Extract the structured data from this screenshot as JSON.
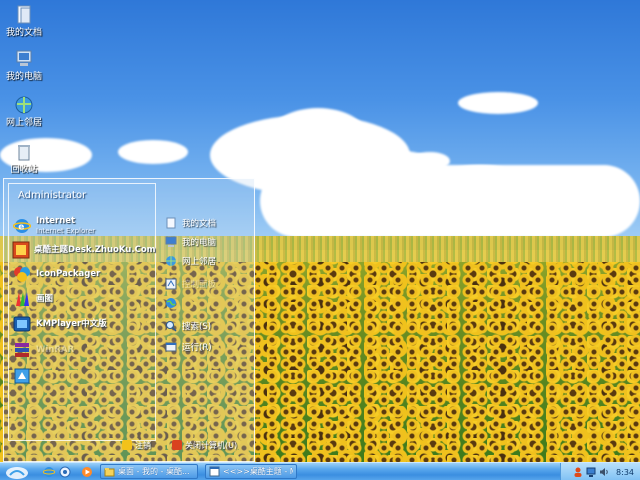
{
  "desktop": {
    "icons": [
      {
        "label": "我的文档",
        "icon": "documents-icon"
      },
      {
        "label": "我的电脑",
        "icon": "computer-icon"
      },
      {
        "label": "网上邻居",
        "icon": "network-icon"
      },
      {
        "label": "回收站",
        "icon": "recycle-bin-icon"
      }
    ]
  },
  "start_menu": {
    "user_name": "Administrator",
    "programs": [
      {
        "title": "Internet",
        "subtitle": "Internet Explorer",
        "icon": "ie-icon"
      },
      {
        "title": "桌酷主题Desk.ZhuoKu.Com",
        "subtitle": "",
        "icon": "zhuoku-icon"
      },
      {
        "title": "IconPackager",
        "subtitle": "",
        "icon": "iconpackager-icon"
      },
      {
        "title": "画图",
        "subtitle": "",
        "icon": "paint-icon"
      },
      {
        "title": "KMPlayer中文版",
        "subtitle": "",
        "icon": "kmplayer-icon"
      },
      {
        "title": "WinRAR",
        "subtitle": "",
        "icon": "winrar-icon"
      },
      {
        "title": "",
        "subtitle": "",
        "icon": "app-icon"
      }
    ],
    "places": [
      {
        "label": "我的文档",
        "icon": "documents-icon"
      },
      {
        "label": "我的电脑",
        "icon": "computer-icon"
      },
      {
        "label": "网上邻居",
        "icon": "network-icon"
      },
      {
        "label": "控制面板",
        "icon": "control-panel-icon"
      },
      {
        "label": "",
        "icon": "globe-icon"
      },
      {
        "label": "搜索(S)",
        "icon": "search-icon"
      },
      {
        "label": "运行(R)",
        "icon": "run-icon"
      }
    ],
    "bottom": {
      "logoff_label": "注销",
      "shutdown_label": "关闭计算机(U)"
    }
  },
  "taskbar": {
    "tasks": [
      {
        "label": "桌面 - 我的 - 桌酷...",
        "icon": "folder-icon"
      },
      {
        "label": "<<>>桌酷主题 - M...",
        "icon": "browser-icon"
      }
    ],
    "clock": "8:34"
  }
}
